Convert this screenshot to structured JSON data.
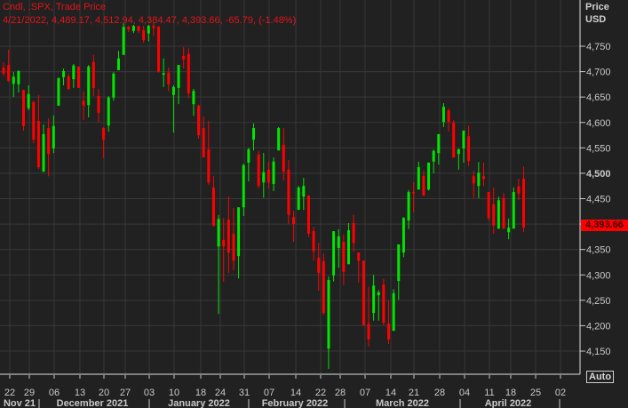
{
  "header": {
    "line1": "Cndl, .SPX, Trade Price",
    "line2": "4/21/2022, 4,489.17, 4,512.94, 4,384.47, 4,393.66, -65.79, (-1.48%)"
  },
  "axis": {
    "title_line1": "Price",
    "title_line2": "USD",
    "auto_label": "Auto",
    "last_price_label": "4,393.66"
  },
  "colors": {
    "up": "#00e600",
    "down": "#ff0000",
    "background": "#212121",
    "grid": "#383838",
    "axis_text": "#c8c8c8",
    "last_price_bg": "#ff0000"
  },
  "chart_data": {
    "type": "candlestick",
    "title": "Cndl, .SPX, Trade Price",
    "ylabel": "Price USD",
    "ylim": [
      4100,
      4800
    ],
    "yticks": [
      4150,
      4200,
      4250,
      4300,
      4350,
      4400,
      4450,
      4500,
      4550,
      4600,
      4650,
      4700,
      4750
    ],
    "ytick_labels": [
      "4,150",
      "4,200",
      "4,250",
      "4,300",
      "4,350",
      "4,400",
      "4,450",
      "4,500",
      "4,550",
      "4,600",
      "4,650",
      "4,700",
      "4,750"
    ],
    "grid": true,
    "xtick_labels": [
      "22",
      "29",
      "06",
      "13",
      "20",
      "27",
      "03",
      "10",
      "18",
      "24",
      "31",
      "07",
      "14",
      "22",
      "28",
      "07",
      "14",
      "21",
      "28",
      "04",
      "11",
      "18",
      "25",
      "02"
    ],
    "month_labels": [
      "Nov 21",
      "December 2021",
      "January 2022",
      "February 2022",
      "March 2022",
      "April 2022"
    ],
    "first_date": "2021-11-19",
    "last_date": "2022-04-21",
    "last": {
      "date": "4/21/2022",
      "open": 4489.17,
      "high": 4512.94,
      "low": 4384.47,
      "close": 4393.66,
      "change": -65.79,
      "change_pct": -1.48
    },
    "ohlc": [
      [
        4708,
        4718,
        4692,
        4696
      ],
      [
        4713,
        4743,
        4680,
        4682
      ],
      [
        4676,
        4699,
        4650,
        4690
      ],
      [
        4675,
        4703,
        4659,
        4701
      ],
      [
        4664,
        4664,
        4584,
        4593
      ],
      [
        4628,
        4673,
        4624,
        4656
      ],
      [
        4640,
        4643,
        4559,
        4566
      ],
      [
        4603,
        4654,
        4508,
        4512
      ],
      [
        4503,
        4596,
        4503,
        4577
      ],
      [
        4589,
        4608,
        4494,
        4538
      ],
      [
        4549,
        4614,
        4540,
        4593
      ],
      [
        4633,
        4689,
        4633,
        4687
      ],
      [
        4689,
        4706,
        4673,
        4701
      ],
      [
        4691,
        4696,
        4664,
        4666
      ],
      [
        4685,
        4715,
        4668,
        4712
      ],
      [
        4710,
        4710,
        4668,
        4668
      ],
      [
        4643,
        4661,
        4605,
        4633
      ],
      [
        4634,
        4713,
        4610,
        4710
      ],
      [
        4719,
        4733,
        4652,
        4668
      ],
      [
        4652,
        4666,
        4600,
        4619
      ],
      [
        4589,
        4591,
        4530,
        4566
      ],
      [
        4594,
        4652,
        4582,
        4649
      ],
      [
        4649,
        4699,
        4643,
        4696
      ],
      [
        4703,
        4741,
        4703,
        4726
      ],
      [
        4733,
        4795,
        4733,
        4788
      ],
      [
        4788,
        4790,
        4778,
        4783
      ],
      [
        4780,
        4792,
        4776,
        4790
      ],
      [
        4790,
        4790,
        4776,
        4780
      ],
      [
        4782,
        4790,
        4757,
        4762
      ],
      [
        4775,
        4792,
        4760,
        4790
      ],
      [
        4790,
        4796,
        4770,
        4786
      ],
      [
        4788,
        4790,
        4698,
        4700
      ],
      [
        4694,
        4726,
        4670,
        4697
      ],
      [
        4698,
        4708,
        4661,
        4675
      ],
      [
        4654,
        4673,
        4580,
        4670
      ],
      [
        4668,
        4713,
        4636,
        4713
      ],
      [
        4731,
        4748,
        4706,
        4724
      ],
      [
        4735,
        4746,
        4648,
        4657
      ],
      [
        4636,
        4666,
        4613,
        4662
      ],
      [
        4633,
        4635,
        4568,
        4575
      ],
      [
        4589,
        4612,
        4531,
        4531
      ],
      [
        4547,
        4603,
        4477,
        4482
      ],
      [
        4472,
        4495,
        4395,
        4397
      ],
      [
        4356,
        4418,
        4223,
        4410
      ],
      [
        4369,
        4412,
        4286,
        4356
      ],
      [
        4409,
        4454,
        4304,
        4344
      ],
      [
        4381,
        4432,
        4309,
        4328
      ],
      [
        4337,
        4433,
        4293,
        4433
      ],
      [
        4433,
        4519,
        4416,
        4516
      ],
      [
        4521,
        4550,
        4484,
        4547
      ],
      [
        4566,
        4598,
        4545,
        4589
      ],
      [
        4537,
        4544,
        4470,
        4475
      ],
      [
        4482,
        4540,
        4452,
        4502
      ],
      [
        4507,
        4523,
        4470,
        4482
      ],
      [
        4479,
        4531,
        4465,
        4523
      ],
      [
        4545,
        4591,
        4545,
        4589
      ],
      [
        4556,
        4589,
        4486,
        4503
      ],
      [
        4507,
        4526,
        4400,
        4418
      ],
      [
        4414,
        4426,
        4365,
        4400
      ],
      [
        4428,
        4475,
        4428,
        4472
      ],
      [
        4454,
        4491,
        4428,
        4475
      ],
      [
        4456,
        4456,
        4374,
        4381
      ],
      [
        4386,
        4395,
        4328,
        4347
      ],
      [
        4334,
        4363,
        4269,
        4304
      ],
      [
        4327,
        4342,
        4222,
        4225
      ],
      [
        4155,
        4297,
        4115,
        4290
      ],
      [
        4299,
        4386,
        4287,
        4386
      ],
      [
        4353,
        4390,
        4314,
        4376
      ],
      [
        4365,
        4379,
        4280,
        4306
      ],
      [
        4321,
        4402,
        4321,
        4388
      ],
      [
        4402,
        4418,
        4346,
        4363
      ],
      [
        4344,
        4344,
        4285,
        4328
      ],
      [
        4328,
        4328,
        4201,
        4201
      ],
      [
        4204,
        4277,
        4159,
        4173
      ],
      [
        4225,
        4300,
        4210,
        4279
      ],
      [
        4260,
        4270,
        4210,
        4266
      ],
      [
        4281,
        4292,
        4201,
        4206
      ],
      [
        4204,
        4250,
        4164,
        4173
      ],
      [
        4190,
        4272,
        4190,
        4264
      ],
      [
        4288,
        4360,
        4251,
        4360
      ],
      [
        4344,
        4414,
        4335,
        4412
      ],
      [
        4407,
        4467,
        4390,
        4463
      ],
      [
        4463,
        4482,
        4423,
        4460
      ],
      [
        4468,
        4523,
        4468,
        4512
      ],
      [
        4495,
        4505,
        4456,
        4456
      ],
      [
        4468,
        4521,
        4466,
        4521
      ],
      [
        4523,
        4547,
        4500,
        4544
      ],
      [
        4540,
        4577,
        4517,
        4577
      ],
      [
        4601,
        4638,
        4591,
        4631
      ],
      [
        4624,
        4628,
        4582,
        4601
      ],
      [
        4600,
        4605,
        4531,
        4531
      ],
      [
        4538,
        4549,
        4507,
        4547
      ],
      [
        4549,
        4584,
        4521,
        4584
      ],
      [
        4573,
        4594,
        4514,
        4524
      ],
      [
        4494,
        4505,
        4451,
        4480
      ],
      [
        4475,
        4522,
        4451,
        4501
      ],
      [
        4494,
        4521,
        4475,
        4489
      ],
      [
        4463,
        4463,
        4407,
        4412
      ],
      [
        4439,
        4472,
        4381,
        4397
      ],
      [
        4391,
        4454,
        4391,
        4447
      ],
      [
        4451,
        4461,
        4391,
        4391
      ],
      [
        4384,
        4411,
        4370,
        4393
      ],
      [
        4391,
        4472,
        4391,
        4463
      ],
      [
        4474,
        4489,
        4447,
        4460
      ],
      [
        4489.17,
        4512.94,
        4384.47,
        4393.66
      ]
    ]
  }
}
